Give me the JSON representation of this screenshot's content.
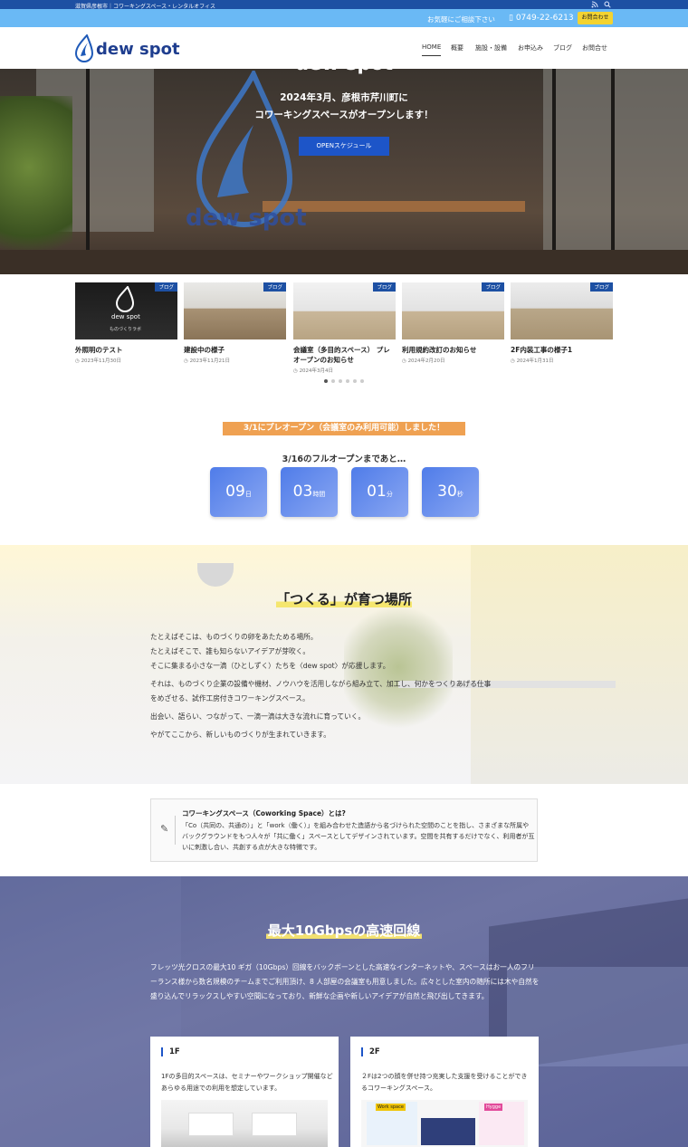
{
  "topbar": {
    "tagline": "滋賀県彦根市｜コワーキングスペース・レンタルオフィス",
    "rss_icon": "rss-icon",
    "search_icon": "search-icon"
  },
  "contact": {
    "question": "お気軽にご相談下さい",
    "phone_icon": "phone-icon",
    "phone": "0749-22-6213",
    "button": "お問合わせ"
  },
  "header": {
    "logo_text": "dew spot",
    "nav": [
      "HOME",
      "概要",
      "施設・設備",
      "お申込み",
      "ブログ",
      "お問合せ"
    ]
  },
  "hero": {
    "title": "dew spot",
    "subtitle_line1": "2024年3月、彦根市芹川町に",
    "subtitle_line2": "コワーキングスペースがオープンします！",
    "button": "OPENスケジュール",
    "logo_watermark": "dew spot"
  },
  "posts": [
    {
      "tag": "ブログ",
      "title": "外照明のテスト",
      "date": "2023年11月30日",
      "sign_brand": "dew spot",
      "sign_sub": "ものづくりラボ"
    },
    {
      "tag": "ブログ",
      "title": "建設中の様子",
      "date": "2023年11月21日"
    },
    {
      "tag": "ブログ",
      "title": "会議室（多目的スペース） プレオープンのお知らせ",
      "date": "2024年3月4日"
    },
    {
      "tag": "ブログ",
      "title": "利用規約改訂のお知らせ",
      "date": "2024年2月20日"
    },
    {
      "tag": "ブログ",
      "title": "2F内装工事の様子1",
      "date": "2024年1月31日"
    }
  ],
  "preopen": {
    "banner": "3/1にプレオープン（会議室のみ利用可能）しました！",
    "until": "3/16のフルオープンまであと…",
    "countdown": [
      {
        "value": "09",
        "unit": "日"
      },
      {
        "value": "03",
        "unit": "時間"
      },
      {
        "value": "01",
        "unit": "分"
      },
      {
        "value": "30",
        "unit": "秒"
      }
    ]
  },
  "tsukuru": {
    "title": "「つくる」が育つ場所",
    "lines": [
      "たとえばそこは、ものづくりの卵をあたためる場所。",
      "たとえばそこで、誰も知らないアイデアが芽吹く。",
      "そこに集まる小さな一滴（ひとしずく）たちを〈dew spot〉が応援します。",
      "それは、ものづくり企業の設備や機材、ノウハウを活用しながら組み立て、加工し、何かをつくりあげる仕事",
      "をめざせる、試作工房付きコワーキングスペース。",
      "出会い、語らい、つながって、一滴一滴は大きな流れに育っていく。",
      "やがてここから、新しいものづくりが生まれていきます。"
    ]
  },
  "coworking": {
    "icon": "pen-icon",
    "title": "コワーキングスペース（Coworking Space）とは?",
    "text": "「Co（共同の、共通の）」と「work（働く）」を組み合わせた造語から名づけられた空間のことを指し、さまざまな所属やバックグラウンドをもつ人々が「共に働く」スペースとしてデザインされています。空間を共有するだけでなく、利用者が互いに刺激し合い、共創する点が大きな特徴です。"
  },
  "speed": {
    "title": "最大10Gbpsの高速回線",
    "text": "フレッツ光クロスの最大10 ギガ（10Gbps）回線をバックボーンとした高速なインターネットや、スペースはお一人のフリーランス様から数名規模のチームまでご利用頂け、8 人部屋の会議室も用意しました。広々とした室内の随所には木や自然を盛り込んでリラックスしやすい空間になっており、新鮮な企画や新しいアイデアが自然と飛び出してきます。",
    "cards": [
      {
        "heading": "1F",
        "text": "1Fの多目的スペースは、セミナーやワークショップ開催などあらゆる用途での利用を想定しています。"
      },
      {
        "heading": "2F",
        "text": "２Fは2つの顔を併せ持つ充実した支援を受けることができるコワーキングスペース。",
        "poster_left": "Work space",
        "poster_right": "Hygge"
      }
    ]
  }
}
